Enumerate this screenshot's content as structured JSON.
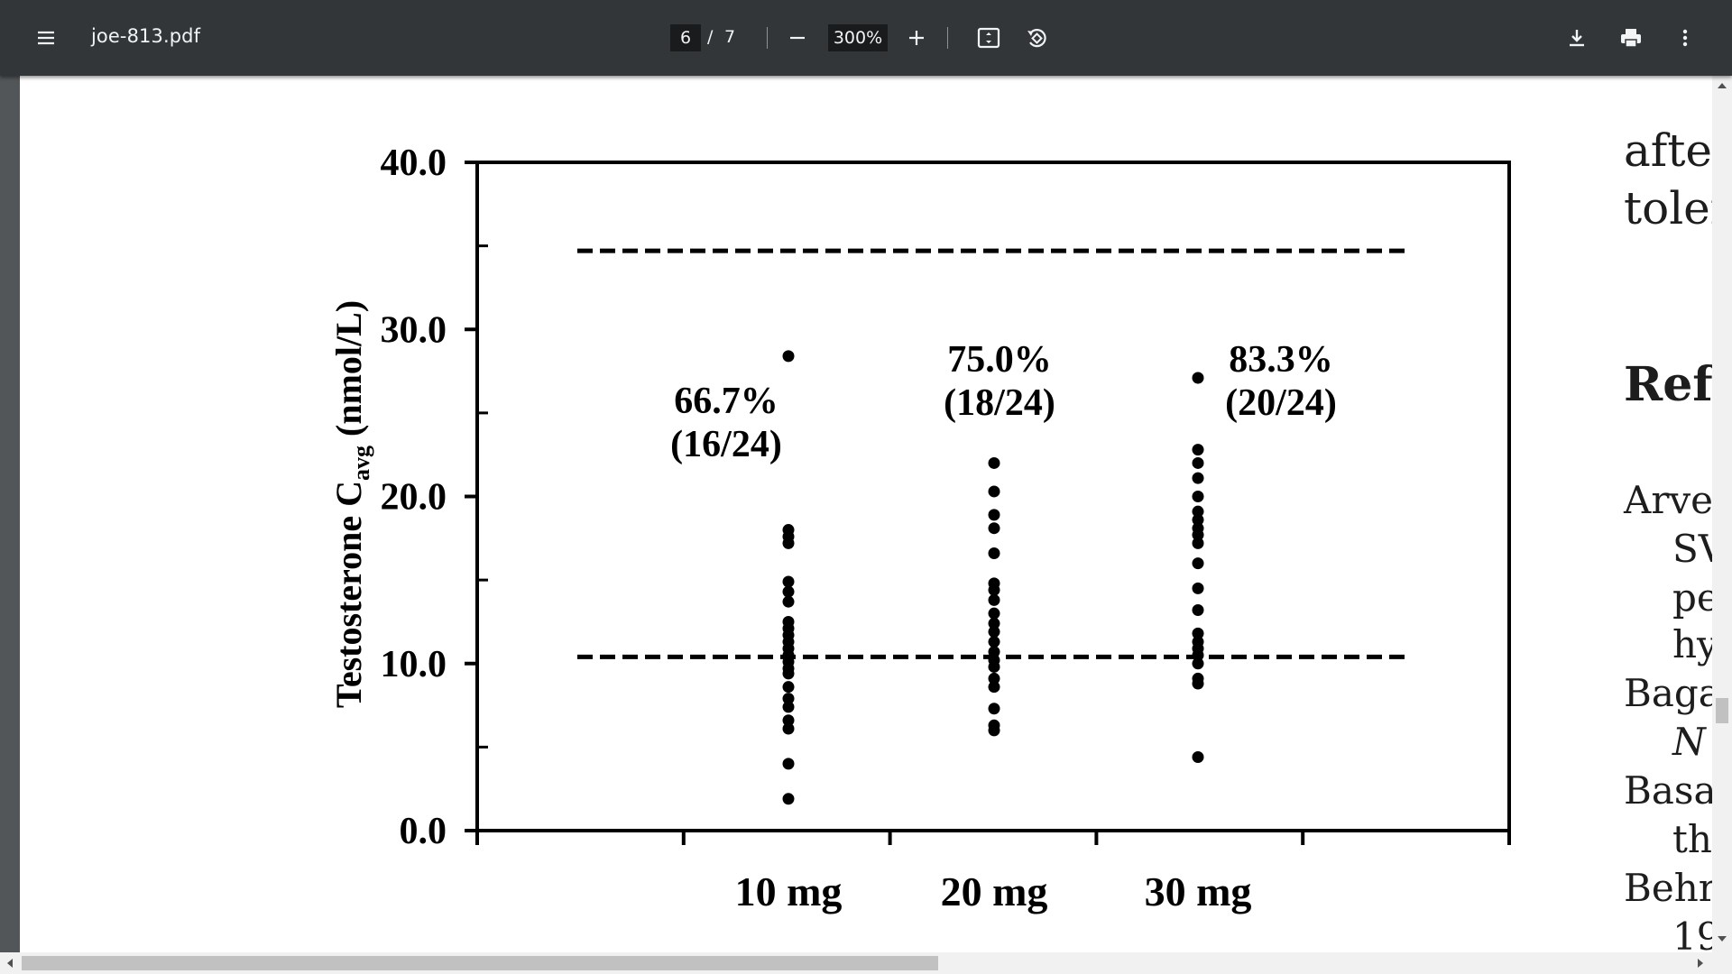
{
  "toolbar": {
    "menu_icon": "hamburger-menu-icon",
    "title": "joe-813.pdf",
    "page_current": "6",
    "page_separator": "/",
    "page_total": "7",
    "zoom_value": "300%",
    "icons": [
      "minus-icon",
      "plus-icon",
      "fit-page-icon",
      "rotate-icon",
      "download-icon",
      "print-icon",
      "more-vert-icon"
    ]
  },
  "page_text": {
    "right_column": [
      "after",
      "toler",
      "Ref",
      "Arve",
      "SV",
      "pe",
      "hy",
      "Baga",
      "N",
      "Basar",
      "th",
      "Behr",
      "19"
    ]
  },
  "colors": {
    "toolbar_bg": "#323639",
    "viewer_bg": "#525659",
    "page_bg": "#ffffff",
    "ink": "#000000"
  },
  "chart_data": {
    "type": "scatter",
    "ylabel": "Testosterone C",
    "ylabel_subscript": "avg",
    "ylabel_unit": "(nmol/L)",
    "categories": [
      "10 mg",
      "20 mg",
      "30 mg"
    ],
    "ylim": [
      0,
      40
    ],
    "yticks": [
      "0.0",
      "10.0",
      "20.0",
      "30.0",
      "40.0"
    ],
    "reference_lines": [
      34.7,
      10.4
    ],
    "annotations": [
      {
        "category": "10 mg",
        "percent": "66.7%",
        "fraction": "(16/24)"
      },
      {
        "category": "20 mg",
        "percent": "75.0%",
        "fraction": "(18/24)"
      },
      {
        "category": "30 mg",
        "percent": "83.3%",
        "fraction": "(20/24)"
      }
    ],
    "series": [
      {
        "category": "10 mg",
        "values": [
          28.4,
          18.0,
          17.6,
          17.2,
          14.9,
          14.3,
          13.7,
          12.5,
          12.1,
          11.7,
          11.3,
          10.9,
          10.5,
          10.1,
          9.7,
          9.4,
          8.6,
          7.9,
          7.4,
          6.6,
          6.1,
          4.0,
          1.9
        ]
      },
      {
        "category": "20 mg",
        "values": [
          22.0,
          20.3,
          18.9,
          18.1,
          16.6,
          14.8,
          14.4,
          13.8,
          13.0,
          12.4,
          11.9,
          11.3,
          10.7,
          10.2,
          9.8,
          9.1,
          8.6,
          7.3,
          6.3,
          6.0
        ]
      },
      {
        "category": "30 mg",
        "values": [
          27.1,
          22.8,
          22.0,
          21.1,
          20.0,
          19.1,
          18.6,
          18.1,
          17.7,
          17.2,
          16.0,
          14.5,
          13.2,
          11.8,
          11.3,
          10.9,
          10.5,
          10.0,
          9.1,
          8.8,
          4.4
        ]
      }
    ]
  }
}
